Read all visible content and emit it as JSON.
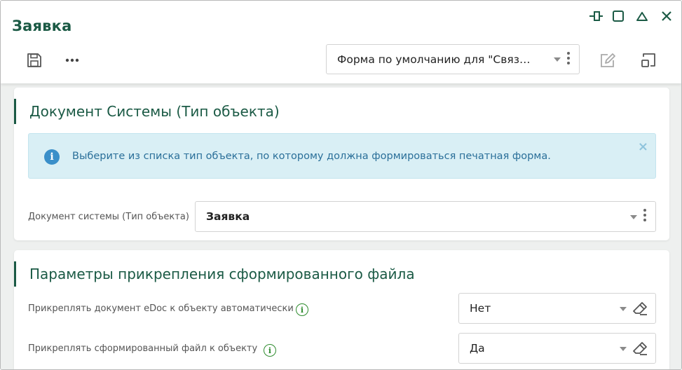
{
  "window": {
    "title": "Заявка",
    "controls": [
      "pin-icon",
      "maximize-icon",
      "collapse-icon",
      "close-icon"
    ]
  },
  "toolbar": {
    "icons": [
      "save-icon",
      "more-icon",
      "edit-icon",
      "restore-icon"
    ],
    "form_select": {
      "value": "Форма по умолчанию для \"Связ…"
    }
  },
  "section1": {
    "title": "Документ Системы (Тип объекта)",
    "alert": {
      "icon": "info-icon",
      "text": "Выберите из списка тип объекта, по которому должна формироваться печатная форма.",
      "close_icon": "close-icon"
    },
    "field": {
      "label": "Документ системы (Тип объекта)",
      "value": "Заявка"
    }
  },
  "section2": {
    "title": "Параметры прикрепления сформированного файла",
    "fields": [
      {
        "label": "Прикреплять документ eDoc к объекту автоматически",
        "value": "Нет"
      },
      {
        "label": "Прикреплять сформированный файл к объекту",
        "value": "Да"
      }
    ]
  },
  "colors": {
    "accent": "#1b5a45",
    "alert_bg": "#d9eff5",
    "alert_text": "#2a6f99",
    "info_green": "#2e8b2e"
  }
}
